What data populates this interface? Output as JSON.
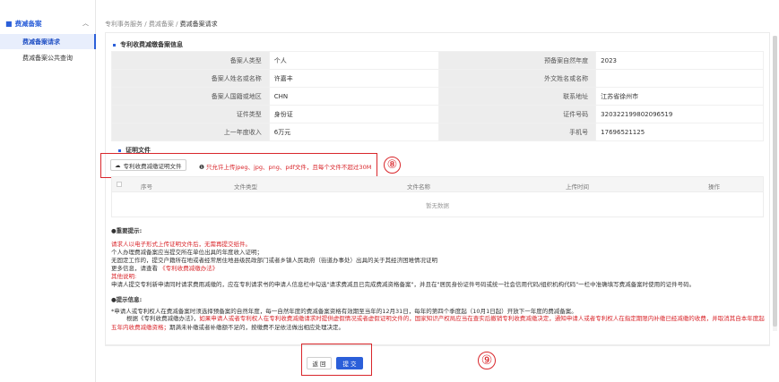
{
  "sidebar": {
    "group_label": "费减备案",
    "items": [
      {
        "label": "费减备案请求",
        "active": true
      },
      {
        "label": "费减备案公共查询",
        "active": false
      }
    ]
  },
  "breadcrumb": [
    "专利事务服务",
    "费减备案",
    "费减备案请求"
  ],
  "info_section": {
    "title": "专利收费减缴备案信息",
    "rows": [
      {
        "k1": "备案人类型",
        "v1": "个人",
        "k2": "预备案自然年度",
        "v2": "2023"
      },
      {
        "k1": "备案人姓名或名称",
        "v1": "许嘉丰",
        "k2": "外文姓名或名称",
        "v2": ""
      },
      {
        "k1": "备案人国籍或地区",
        "v1": "CHN",
        "k2": "联系地址",
        "v2": "江苏省徐州市"
      },
      {
        "k1": "证件类型",
        "v1": "身份证",
        "k2": "证件号码",
        "v2": "320322199802096519"
      },
      {
        "k1": "上一年度收入",
        "v1": "6万元",
        "k2": "手机号",
        "v2": "17696521125"
      }
    ]
  },
  "upload_section": {
    "title": "证明文件",
    "button_label": "专利收费减缴证明文件",
    "hint": "只允许上传jpeg、jpg、png、pdf文件，且每个文件不超过30M",
    "marker": "⑧"
  },
  "file_table": {
    "columns": [
      "序号",
      "文件类型",
      "文件名称",
      "上传时间",
      "操作"
    ],
    "empty_text": "暂无数据"
  },
  "notice": {
    "important_title": "●重要提示:",
    "line1": "请求人以电子形式上传证明文件后，无需再提交纸件。",
    "line2": "个人办理费减备案应当提交所在单位出具的年度收入证明；",
    "line3": "无固定工作的，提交户籍所在地或者经常居住地县级民政部门或者乡镇人民政府（街道办事处）出具的关于其经济困难情况证明",
    "line4_prefix": "更多信息，请查看",
    "line4_link": "《专利收费减缴办法》",
    "other_title": "其他说明:",
    "line5": "申请人提交专利新申请同时请求费用减缴的，应在专利请求书的申请人信息栏中勾选\"请求费减且已完成费减资格备案\"，并且在\"居民身份证件号码或统一社会信用代码/组织机构代码\"一栏中准确填写费减备案时使用的证件号码。",
    "tips_title": "●提示信息:",
    "tip1": "*申请人或专利权人在费减备案时须选择预备案的自然年度，每一自然年度的费减备案资格有效期至当年的12月31日，每年的第四个季度起（10月1日起）开放下一年度的费减备案。",
    "tip2_prefix": "根据《专利收费减缴办法》，",
    "tip2_red": "如果申请人或者专利权人在专利收费减缴请求时提供虚假情况或者虚假证明文件的，国家知识产权局应当在查实后撤销专利收费减缴决定，通知申请人或者专利权人在指定期限内补缴已经减缴的收费，并取消其自本年度起五年内收费减缴资格；",
    "tip3": "期满未补缴或者补缴额不足的，按缴费不足依法做出相应处理决定。"
  },
  "footer": {
    "back_label": "返 回",
    "submit_label": "提 交",
    "marker": "⑨"
  },
  "colors": {
    "primary": "#2b5fd9",
    "annotation_red": "#d9262b"
  }
}
